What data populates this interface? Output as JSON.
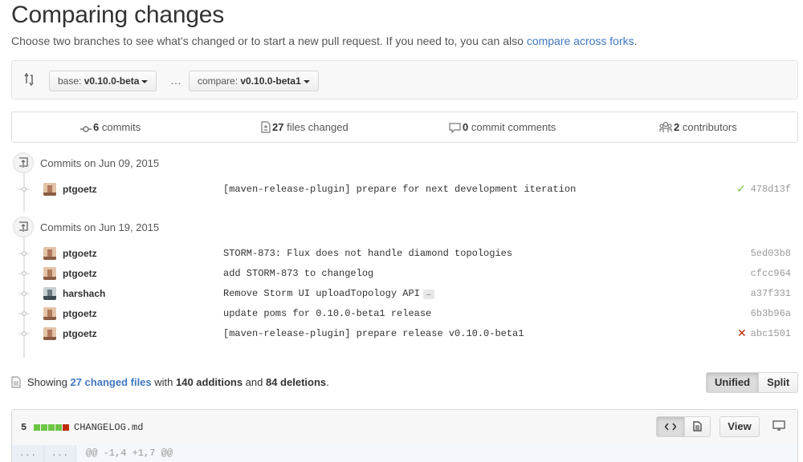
{
  "header": {
    "title": "Comparing changes",
    "subtitle_text": "Choose two branches to see what’s changed or to start a new pull request. If you need to, you can also ",
    "subtitle_link": "compare across forks",
    "subtitle_end": "."
  },
  "range": {
    "base_prefix": "base: ",
    "base_branch": "v0.10.0-beta",
    "separator": "…",
    "compare_prefix": "compare: ",
    "compare_branch": "v0.10.0-beta1"
  },
  "summary": {
    "commits_count": "6",
    "commits_label": " commits",
    "files_count": "27",
    "files_label": " files changed",
    "comments_count": "0",
    "comments_label": " commit comments",
    "contributors_count": "2",
    "contributors_label": " contributors"
  },
  "commit_groups": [
    {
      "title": "Commits on Jun 09, 2015",
      "commits": [
        {
          "author": "ptgoetz",
          "message": "[maven-release-plugin] prepare for next development iteration",
          "sha": "478d13f",
          "status": "success"
        }
      ]
    },
    {
      "title": "Commits on Jun 19, 2015",
      "commits": [
        {
          "author": "ptgoetz",
          "message": "STORM-873: Flux does not handle diamond topologies",
          "sha": "5ed03b8",
          "status": ""
        },
        {
          "author": "ptgoetz",
          "message": "add STORM-873 to changelog",
          "sha": "cfcc964",
          "status": ""
        },
        {
          "author": "harshach",
          "message": "Remove Storm UI uploadTopology API",
          "sha": "a37f331",
          "status": "",
          "expander": "…"
        },
        {
          "author": "ptgoetz",
          "message": "update poms for 0.10.0-beta1 release",
          "sha": "6b3b96a",
          "status": ""
        },
        {
          "author": "ptgoetz",
          "message": "[maven-release-plugin] prepare release v0.10.0-beta1",
          "sha": "abc1501",
          "status": "failure"
        }
      ]
    }
  ],
  "showing": {
    "prefix": "Showing ",
    "files_link": "27 changed files",
    "mid1": " with ",
    "additions": "140 additions",
    "mid2": " and ",
    "deletions": "84 deletions",
    "end": "."
  },
  "view_toggle": {
    "unified": "Unified",
    "split": "Split",
    "selected": "Unified"
  },
  "file": {
    "changes": "5",
    "name": "CHANGELOG.md",
    "view_label": "View",
    "diffstat": {
      "added_blocks": 4,
      "deleted_blocks": 1
    }
  },
  "diff": {
    "left_num": "...",
    "right_num": "...",
    "hunk": "@@ -1,4 +1,7 @@"
  },
  "colors": {
    "link": "#4078c0",
    "success": "#6cc644",
    "failure": "#bd2c00",
    "diff_add": "#6cc644",
    "diff_del": "#bd2c00"
  }
}
